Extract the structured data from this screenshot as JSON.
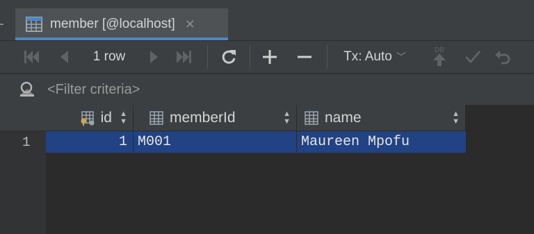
{
  "tab": {
    "title": "member [@localhost]",
    "icon": "table-icon",
    "close_icon": "close-icon"
  },
  "toolbar": {
    "first_icon": "first-page-icon",
    "prev_icon": "previous-page-icon",
    "row_count": "1 row",
    "next_icon": "next-page-icon",
    "last_icon": "last-page-icon",
    "reload_icon": "reload-icon",
    "add_icon": "add-row-icon",
    "remove_icon": "remove-row-icon",
    "tx_mode": "Tx: Auto",
    "db_submit_icon": "db-submit-icon",
    "commit_icon": "commit-icon",
    "rollback_icon": "rollback-icon"
  },
  "filter": {
    "placeholder": "<Filter criteria>",
    "value": "",
    "icon": "filter-icon"
  },
  "grid": {
    "columns": [
      {
        "label": "id",
        "icon": "primary-key-column-icon"
      },
      {
        "label": "memberId",
        "icon": "column-icon"
      },
      {
        "label": "name",
        "icon": "column-icon"
      }
    ],
    "rows": [
      {
        "row_number": "1",
        "cells": [
          "1",
          "M001",
          "Maureen Mpofu"
        ]
      }
    ],
    "selection_color": "#214283"
  },
  "colors": {
    "accent": "#4a88c7",
    "background": "#2b2b2b",
    "panel": "#3c3f41"
  }
}
